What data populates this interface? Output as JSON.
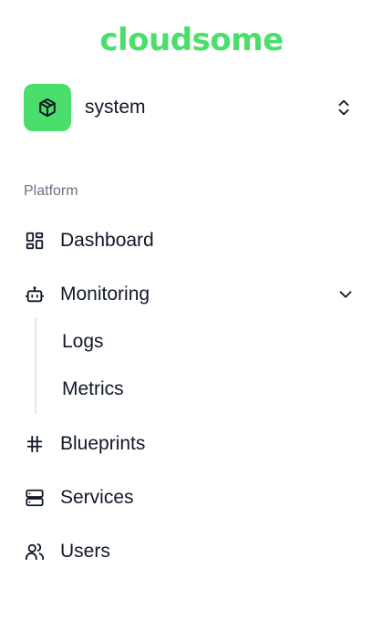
{
  "brand": {
    "logo_text": "cloudsome",
    "accent": "#4ade6a"
  },
  "team": {
    "name": "system",
    "icon": "package-icon",
    "switch_icon": "chevrons-up-down-icon"
  },
  "nav": {
    "section_label": "Platform",
    "items": [
      {
        "label": "Dashboard",
        "icon": "layout-grid-icon"
      },
      {
        "label": "Monitoring",
        "icon": "bot-icon",
        "expanded": true,
        "children": [
          {
            "label": "Logs"
          },
          {
            "label": "Metrics"
          }
        ]
      },
      {
        "label": "Blueprints",
        "icon": "hash-icon"
      },
      {
        "label": "Services",
        "icon": "server-icon"
      },
      {
        "label": "Users",
        "icon": "users-icon"
      }
    ]
  }
}
